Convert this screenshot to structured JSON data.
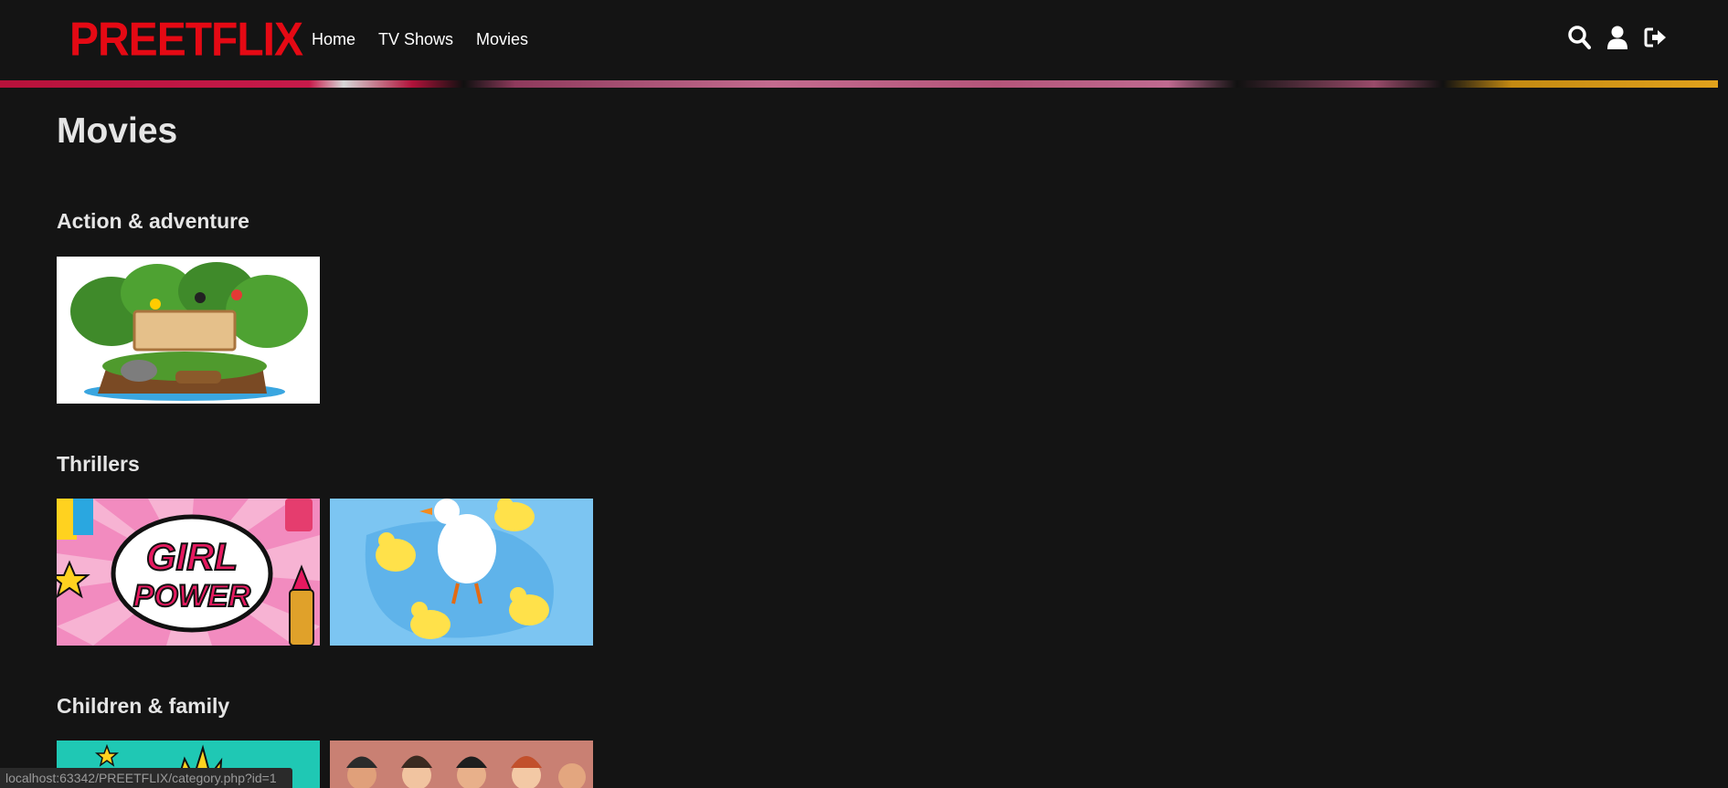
{
  "app": {
    "logo_text": "PREETFLIX",
    "brand_color": "#e50914"
  },
  "nav": {
    "items": [
      {
        "label": "Home"
      },
      {
        "label": "TV Shows"
      },
      {
        "label": "Movies"
      }
    ]
  },
  "header_icons": [
    "search-icon",
    "user-icon",
    "sign-out-icon"
  ],
  "page": {
    "title": "Movies"
  },
  "categories": [
    {
      "title": "Action & adventure",
      "thumbnails": [
        "jungle-island-thumbnail"
      ]
    },
    {
      "title": "Thrillers",
      "thumbnails": [
        "girl-power-thumbnail",
        "ducks-thumbnail"
      ]
    },
    {
      "title": "Children & family",
      "thumbnails": [
        "comic-burst-thumbnail",
        "people-group-thumbnail"
      ]
    }
  ],
  "thumbnail_text": {
    "girl_power_line1": "GIRL",
    "girl_power_line2": "POWER"
  },
  "status_bar": {
    "url": "localhost:63342/PREETFLIX/category.php?id=1"
  }
}
